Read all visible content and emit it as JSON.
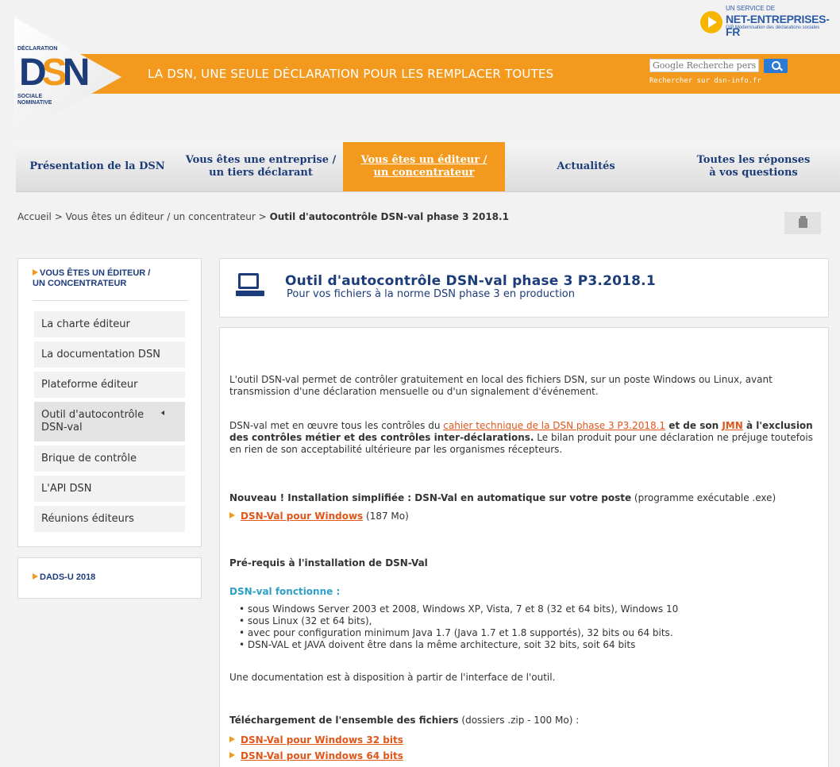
{
  "header": {
    "service_small": "UN SERVICE DE",
    "service_brand": "NET-ENTREPRISES-FR",
    "service_tagline": "GIP Modernisation des déclarations sociales",
    "logo_top": "DÉCLARATION",
    "logo_dsn_d": "D",
    "logo_dsn_s": "S",
    "logo_dsn_n": "N",
    "logo_bottom1": "SOCIALE",
    "logo_bottom2": "NOMINATIVE",
    "banner_title": "LA DSN, UNE SEULE DÉCLARATION POUR LES REMPLACER TOUTES",
    "search_placeholder": "Google Recherche personn",
    "search_hint": "Rechercher sur dsn-info.fr"
  },
  "nav": [
    {
      "l1": "Présentation de la DSN",
      "l2": ""
    },
    {
      "l1": "Vous êtes une entreprise /",
      "l2": "un tiers déclarant"
    },
    {
      "l1": "Vous êtes un éditeur /",
      "l2": "un concentrateur"
    },
    {
      "l1": "Actualités",
      "l2": ""
    },
    {
      "l1": "Toutes les réponses",
      "l2": "à vos questions"
    }
  ],
  "breadcrumb": {
    "home": "Accueil",
    "sep": ">",
    "section": "Vous êtes un éditeur / un concentrateur",
    "current": "Outil d'autocontrôle DSN-val phase 3 2018.1"
  },
  "sidebar": {
    "heading_l1": "VOUS ÊTES UN ÉDITEUR /",
    "heading_l2": "UN CONCENTRATEUR",
    "items": [
      {
        "label": "La charte éditeur"
      },
      {
        "label": "La documentation DSN"
      },
      {
        "label": "Plateforme éditeur"
      },
      {
        "label": "Outil d'autocontrôle DSN-val"
      },
      {
        "label": "Brique de contrôle"
      },
      {
        "label": "L'API DSN"
      },
      {
        "label": "Réunions éditeurs"
      }
    ],
    "box2": "DADS-U 2018"
  },
  "page": {
    "title": "Outil d'autocontrôle DSN-val phase 3 P3.2018.1",
    "subtitle": "Pour vos fichiers à la norme DSN phase 3 en production"
  },
  "content": {
    "p1": "L'outil DSN-val permet de contrôler gratuitement en local des fichiers DSN, sur un poste Windows ou Linux, avant transmission d'une déclaration mensuelle ou d'un signalement d'événement.",
    "p2_a": "DSN-val met en œuvre tous les contrôles du ",
    "p2_link1": "cahier technique de la DSN phase 3 P3.2018.1",
    "p2_b": " et de son ",
    "p2_link2": "JMN",
    "p2_c": " à l'exclusion des contrôles métier et des contrôles inter-déclarations.",
    "p2_d": " Le bilan produit pour une déclaration ne préjuge toutefois en rien de son acceptabilité ultérieure par les organismes récepteurs.",
    "new_bold": "Nouveau ! Installation simplifiée : DSN-Val en automatique sur votre poste",
    "new_rest": " (programme exécutable .exe)",
    "dl_win_label": "DSN-Val pour Windows",
    "dl_win_size": " (187 Mo)",
    "prereq_title": "Pré-requis à l'installation de DSN-Val",
    "works_title": "DSN-val fonctionne :",
    "bullets": [
      "• sous Windows Server 2003 et 2008, Windows XP, Vista, 7 et 8 (32 et 64 bits), Windows 10",
      "• sous Linux (32 et 64 bits),",
      "• avec pour configuration minimum Java 1.7 (Java 1.7 et 1.8 supportés), 32 bits ou 64 bits.",
      "• DSN-VAL et JAVA doivent être dans la même architecture, soit 32 bits, soit 64 bits"
    ],
    "doc_note": "Une documentation est à disposition à partir de l'interface de l'outil.",
    "dl_all_bold": "Téléchargement de l'ensemble des fichiers",
    "dl_all_rest": " (dossiers .zip - 100 Mo) :",
    "dl_32": "DSN-Val pour Windows 32 bits",
    "dl_64": "DSN-Val pour Windows 64 bits"
  }
}
